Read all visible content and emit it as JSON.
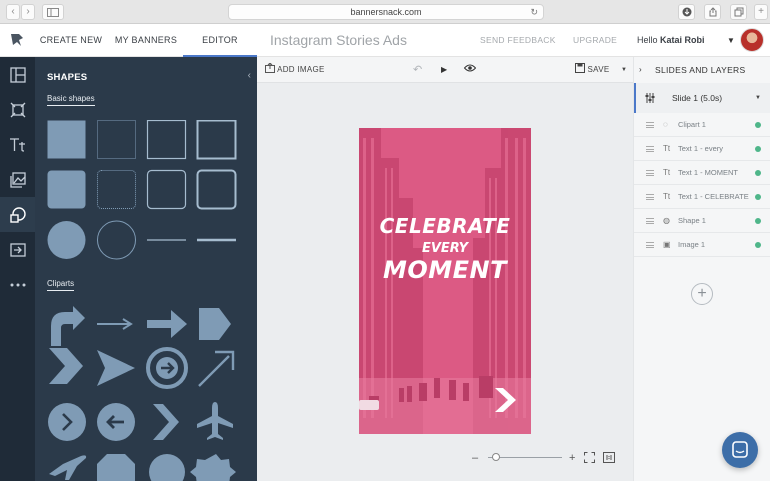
{
  "browser": {
    "url": "bannersnack.com",
    "back": "‹",
    "forward": "›"
  },
  "topbar": {
    "nav": [
      "CREATE NEW",
      "MY BANNERS",
      "EDITOR"
    ],
    "active_nav": "EDITOR",
    "doc_title": "Instagram Stories Ads",
    "send_feedback": "SEND FEEDBACK",
    "upgrade": "UPGRADE",
    "hello": "Hello",
    "user_name": "Katai Robi"
  },
  "rail": {
    "icons": [
      "layout-icon",
      "resize-icon",
      "text-icon",
      "image-icon",
      "shapes-icon",
      "export-icon",
      "more-icon"
    ],
    "active": "shapes-icon"
  },
  "shapes_panel": {
    "title": "SHAPES",
    "collapse": "‹",
    "basic_label": "Basic shapes",
    "cliparts_label": "Cliparts",
    "shape_color": "#7f9bb5"
  },
  "toolbar": {
    "add_image": "ADD IMAGE",
    "save": "SAVE"
  },
  "banner": {
    "line1": "CELEBRATE",
    "line2": "EVERY",
    "line3": "MOMENT",
    "overlay_color": "#d9557f"
  },
  "zoom": {
    "minus": "–",
    "plus": "+",
    "level": 0.05
  },
  "layers_panel": {
    "title": "SLIDES AND LAYERS",
    "slide_label": "Slide 1 (5.0s)",
    "layers": [
      {
        "icon": "clipart-icon",
        "label": "Clipart 1"
      },
      {
        "icon": "text-icon",
        "label": "Text 1 - every"
      },
      {
        "icon": "text-icon",
        "label": "Text 1 - MOMENT"
      },
      {
        "icon": "text-icon",
        "label": "Text 1 - CELEBRATE"
      },
      {
        "icon": "shape-icon",
        "label": "Shape 1"
      },
      {
        "icon": "image-icon",
        "label": "Image 1"
      }
    ],
    "add": "+"
  }
}
